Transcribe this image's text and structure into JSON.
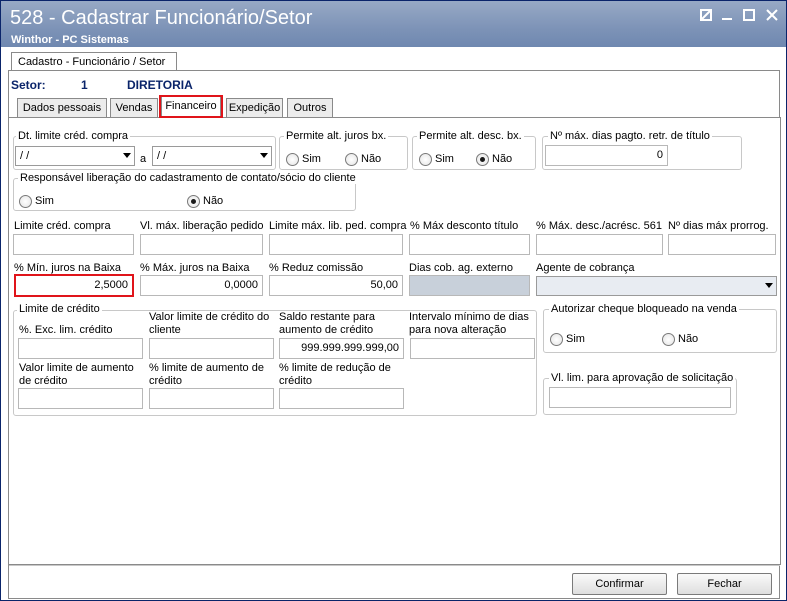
{
  "window": {
    "title": "528 - Cadastrar Funcionário/Setor",
    "subtitle": "Winthor - PC Sistemas",
    "controls": [
      "restore-icon",
      "minimize-icon",
      "maximize-icon",
      "close-icon"
    ]
  },
  "outer_tab": "Cadastro - Funcionário / Setor",
  "setor": {
    "label": "Setor:",
    "code": "1",
    "name": "DIRETORIA"
  },
  "tabs": [
    {
      "label": "Dados pessoais"
    },
    {
      "label": "Vendas"
    },
    {
      "label": "Financeiro",
      "active": true
    },
    {
      "label": "Expedição"
    },
    {
      "label": "Outros"
    }
  ],
  "financeiro": {
    "dt_limite": {
      "label": "Dt. limite créd. compra",
      "from": " / /",
      "separator": "a",
      "to": " / /"
    },
    "permite_juros": {
      "label": "Permite alt. juros bx.",
      "sim": "Sim",
      "nao": "Não",
      "selected": "none"
    },
    "permite_desc": {
      "label": "Permite alt. desc. bx.",
      "sim": "Sim",
      "nao": "Não",
      "selected": "nao"
    },
    "nmax_dias": {
      "label": "Nº máx. dias pagto. retr. de título",
      "value": "0"
    },
    "responsavel": {
      "label": "Responsável liberação do cadastramento de contato/sócio do cliente",
      "sim": "Sim",
      "nao": "Não",
      "selected": "nao"
    },
    "row1": [
      {
        "label": "Limite créd. compra",
        "value": ""
      },
      {
        "label": "Vl. máx. liberação pedido",
        "value": ""
      },
      {
        "label": "Limite máx. lib. ped. compra",
        "value": ""
      },
      {
        "label": "% Máx desconto título",
        "value": ""
      },
      {
        "label": "% Máx. desc./acrésc. 561",
        "value": ""
      },
      {
        "label": "Nº dias máx prorrog.",
        "value": ""
      }
    ],
    "row2": [
      {
        "label": "% Mín. juros na Baixa",
        "value": "2,5000"
      },
      {
        "label": "% Máx. juros na Baixa",
        "value": "0,0000"
      },
      {
        "label": "% Reduz  comissão",
        "value": "50,00"
      },
      {
        "label": "Dias cob. ag. externo",
        "value": ""
      }
    ],
    "agente": {
      "label": "Agente de cobrança",
      "value": ""
    },
    "limite_credito": {
      "title": "Limite de crédito",
      "exc_label": "%. Exc. lim. crédito",
      "valor_limite_label": "Valor limite de crédito do cliente",
      "saldo_label": "Saldo restante para aumento de crédito",
      "saldo_value": "999.999.999.999,00",
      "intervalo_label": "Intervalo mínimo de dias para nova alteração",
      "valor_aumento_label": "Valor limite de aumento de crédito",
      "pct_aumento_label": "% limite de aumento de crédito",
      "pct_reducao_label": "% limite de redução de crédito"
    },
    "autorizar_cheque": {
      "label": "Autorizar cheque bloqueado na venda",
      "sim": "Sim",
      "nao": "Não"
    },
    "vl_lim_aprov": {
      "label": "Vl. lim. para aprovação de solicitação",
      "value": ""
    }
  },
  "buttons": {
    "confirmar": "Confirmar",
    "fechar": "Fechar"
  },
  "colors": {
    "title_bar": "#7d93b7",
    "highlight": "#e0141a",
    "disabled_field": "#c8d0da"
  }
}
